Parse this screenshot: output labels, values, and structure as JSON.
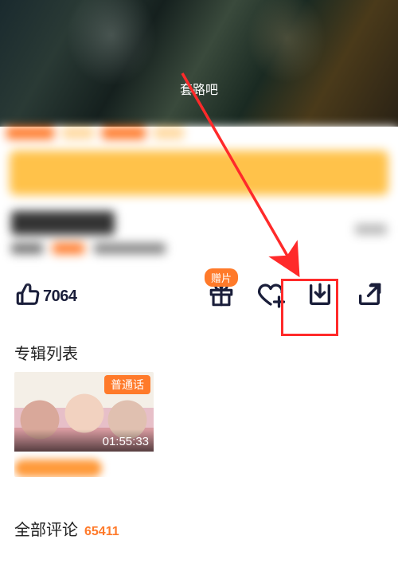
{
  "video": {
    "subtitle": "套路吧"
  },
  "actions": {
    "like_count": "7064",
    "gift_badge": "赠片"
  },
  "album": {
    "section_title": "专辑列表",
    "items": [
      {
        "tag": "普通话",
        "duration": "01:55:33"
      }
    ]
  },
  "comments": {
    "title": "全部评论",
    "count": "65411"
  }
}
